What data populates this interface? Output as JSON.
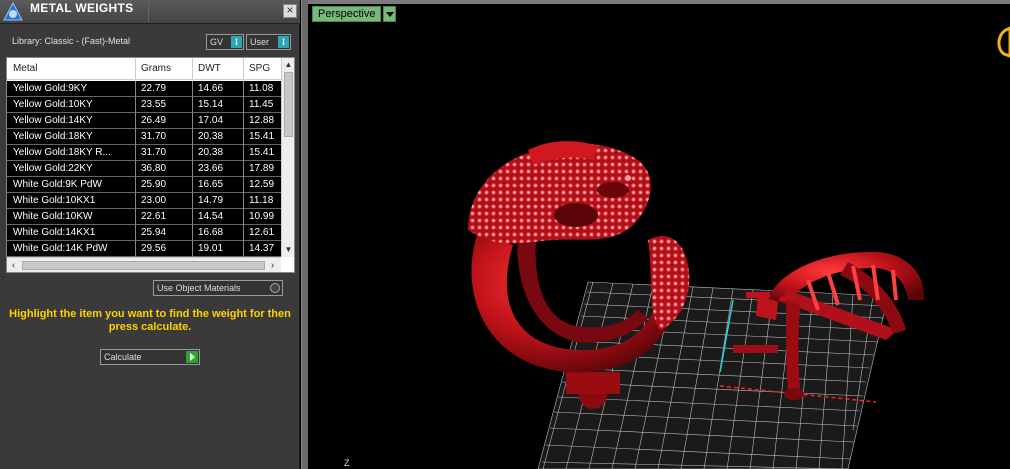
{
  "panel": {
    "title": "METAL WEIGHTS",
    "close_label": "×",
    "library_label": "Library: Classic - (Fast)-Metal",
    "toggles": [
      {
        "label": "GV",
        "badge": "I"
      },
      {
        "label": "User",
        "badge": "I"
      }
    ],
    "table": {
      "columns": [
        "Metal",
        "Grams",
        "DWT",
        "SPG"
      ],
      "rows": [
        [
          "Yellow Gold:9KY",
          "22.79",
          "14.66",
          "11.08"
        ],
        [
          "Yellow Gold:10KY",
          "23.55",
          "15.14",
          "11.45"
        ],
        [
          "Yellow Gold:14KY",
          "26.49",
          "17.04",
          "12.88"
        ],
        [
          "Yellow Gold:18KY",
          "31.70",
          "20.38",
          "15.41"
        ],
        [
          "Yellow Gold:18KY R...",
          "31.70",
          "20.38",
          "15.41"
        ],
        [
          "Yellow Gold:22KY",
          "36.80",
          "23.66",
          "17.89"
        ],
        [
          "White Gold:9K PdW",
          "25.90",
          "16.65",
          "12.59"
        ],
        [
          "White Gold:10KX1",
          "23.00",
          "14.79",
          "11.18"
        ],
        [
          "White Gold:10KW",
          "22.61",
          "14.54",
          "10.99"
        ],
        [
          "White Gold:14KX1",
          "25.94",
          "16.68",
          "12.61"
        ],
        [
          "White Gold:14K PdW",
          "29.56",
          "19.01",
          "14.37"
        ]
      ]
    },
    "use_object_materials": "Use Object Materials",
    "instructions": "Highlight the item you want to find the weight for then press calculate.",
    "calculate_label": "Calculate"
  },
  "viewport": {
    "view_label": "Perspective",
    "axis_label": "Z"
  },
  "colors": {
    "panel_bg": "#3a3a3a",
    "row_bg": "#000000",
    "instruction_text": "#ffd200",
    "badge": "#2aa6b5",
    "model_red": "#c0121a",
    "viewport_tab": "#78b878"
  },
  "icons": [
    "app-logo-icon",
    "close-icon",
    "radio-icon",
    "play-icon",
    "dropdown-arrow-icon",
    "scroll-up-icon",
    "scroll-down-icon",
    "scroll-left-icon",
    "scroll-right-icon"
  ]
}
